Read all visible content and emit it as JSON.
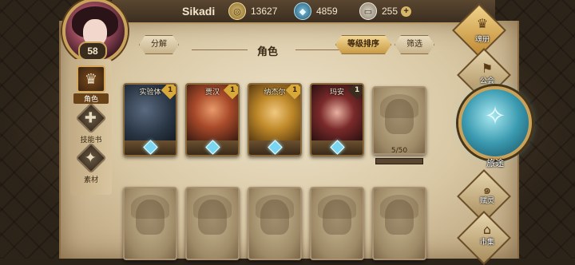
{
  "player": {
    "name": "Sikadi",
    "level": "58"
  },
  "resources": {
    "gold": {
      "value": "13627",
      "icon": "gold-coin-icon"
    },
    "gems": {
      "value": "4859",
      "icon": "crystal-icon"
    },
    "cards": {
      "value": "255",
      "icon": "card-pack-icon"
    },
    "plus": "+"
  },
  "left_nav": [
    {
      "label": "角色",
      "icon": "character-icon",
      "active": true
    },
    {
      "label": "技能书",
      "icon": "skill-book-icon",
      "active": false
    },
    {
      "label": "素材",
      "icon": "materials-icon",
      "active": false
    }
  ],
  "header": {
    "decompose": "分解",
    "title": "角色",
    "sort": "等级排序",
    "filter": "筛选"
  },
  "characters": [
    {
      "name": "实验体",
      "stars": "1",
      "state": "owned",
      "palette": [
        "#3a4a5a",
        "#1a2630"
      ]
    },
    {
      "name": "贾汉",
      "stars": "1",
      "state": "owned",
      "palette": [
        "#c86a3a",
        "#3a1a10"
      ]
    },
    {
      "name": "纳杰尔",
      "stars": "1",
      "state": "owned",
      "palette": [
        "#d8a83a",
        "#5a3a10"
      ]
    },
    {
      "name": "玛安",
      "stars": "1",
      "state": "owned-dark",
      "palette": [
        "#7a2a2a",
        "#2a1010"
      ]
    },
    {
      "name": "",
      "stars": "",
      "state": "shard",
      "shards": "5/50"
    }
  ],
  "locked_row_count_label": "",
  "right_menu": {
    "handbook": "魂册",
    "guild": "公会",
    "travel": "旅途",
    "gift": "赋灵",
    "market": "市集"
  }
}
